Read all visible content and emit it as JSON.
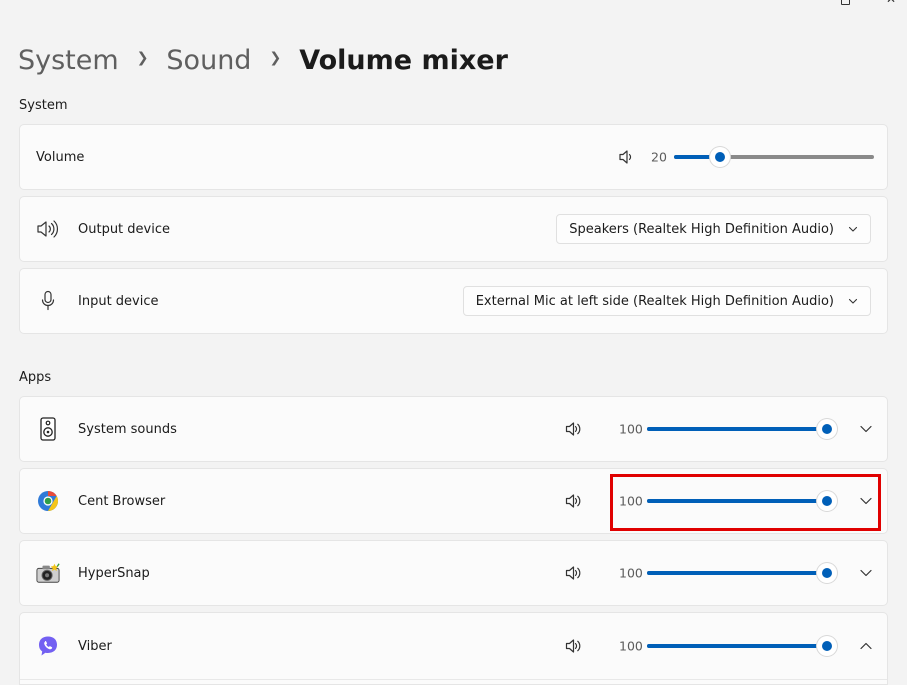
{
  "breadcrumb": {
    "level1": "System",
    "level2": "Sound",
    "current": "Volume mixer"
  },
  "system_section": {
    "title": "System",
    "volume": {
      "label": "Volume",
      "value": "20",
      "level_percent": 20,
      "icon": "speaker-low-icon"
    },
    "output_device": {
      "label": "Output device",
      "selected": "Speakers (Realtek High Definition Audio)",
      "icon": "speaker-icon"
    },
    "input_device": {
      "label": "Input device",
      "selected": "External Mic at left side (Realtek High Definition Audio)",
      "icon": "microphone-icon"
    }
  },
  "apps_section": {
    "title": "Apps",
    "apps": [
      {
        "name": "System sounds",
        "value": "100",
        "level_percent": 100,
        "icon": "system-sounds-icon",
        "expanded": false
      },
      {
        "name": "Cent Browser",
        "value": "100",
        "level_percent": 100,
        "icon": "cent-browser-icon",
        "expanded": false
      },
      {
        "name": "HyperSnap",
        "value": "100",
        "level_percent": 100,
        "icon": "hypersnap-icon",
        "expanded": false
      },
      {
        "name": "Viber",
        "value": "100",
        "level_percent": 100,
        "icon": "viber-icon",
        "expanded": true
      }
    ]
  },
  "colors": {
    "accent": "#005fb8",
    "highlight": "#e00000",
    "background": "#f3f3f3",
    "card": "#fbfbfb"
  }
}
